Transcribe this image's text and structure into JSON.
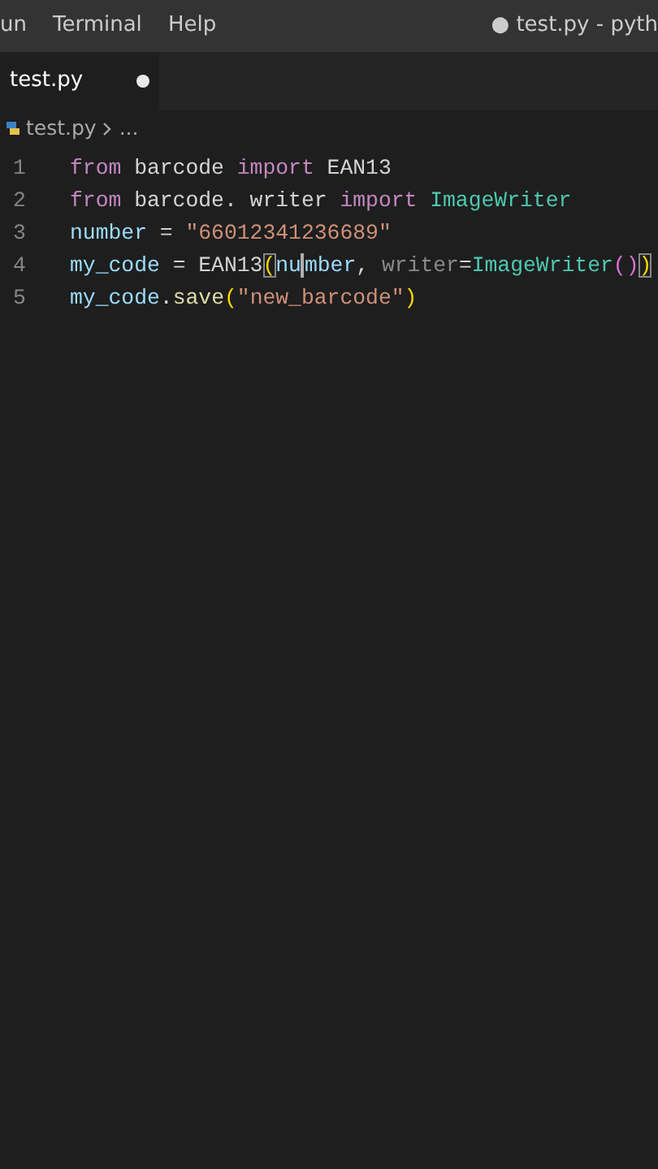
{
  "menu_bar": {
    "items": [
      "un",
      "Terminal",
      "Help"
    ],
    "title": "● test.py - pyth"
  },
  "tabs": [
    {
      "label": "test.py",
      "selected": true,
      "modified": true
    }
  ],
  "breadcrumb": [
    "test.py",
    "..."
  ],
  "code_lines": [
    {
      "number": "1",
      "tokens": [
        {
          "kind": "keyword",
          "text": "from"
        },
        {
          "kind": "plain",
          "text": " barcode "
        },
        {
          "kind": "keyword",
          "text": "import"
        },
        {
          "kind": "plain",
          "text": " EAN13"
        }
      ]
    },
    {
      "number": "2",
      "tokens": [
        {
          "kind": "keyword",
          "text": "from"
        },
        {
          "kind": "plain",
          "text": " barcode. writer "
        },
        {
          "kind": "keyword",
          "text": "import"
        },
        {
          "kind": "class",
          "text": " ImageWriter"
        }
      ]
    },
    {
      "number": "3",
      "tokens": [
        {
          "kind": "variable",
          "text": "number"
        },
        {
          "kind": "plain",
          "text": " = "
        },
        {
          "kind": "string",
          "text": "\"66012341236689\""
        }
      ]
    },
    {
      "number": "4",
      "tokens": [
        {
          "kind": "variable",
          "text": "my_code"
        },
        {
          "kind": "plain",
          "text": " = EAN13"
        },
        {
          "kind": "paren",
          "text": "(",
          "matched": true
        },
        {
          "kind": "variable",
          "text": "nu",
          "cursor_after": true
        },
        {
          "kind": "variable",
          "text": "mber"
        },
        {
          "kind": "plain",
          "text": ", "
        },
        {
          "kind": "param",
          "text": "writer"
        },
        {
          "kind": "plain",
          "text": "="
        },
        {
          "kind": "class",
          "text": "ImageWriter"
        },
        {
          "kind": "paren2",
          "text": "()"
        },
        {
          "kind": "paren",
          "text": ")",
          "matched": true
        }
      ]
    },
    {
      "number": "5",
      "tokens": [
        {
          "kind": "variable",
          "text": "my_code"
        },
        {
          "kind": "plain",
          "text": "."
        },
        {
          "kind": "function",
          "text": "save"
        },
        {
          "kind": "paren",
          "text": "("
        },
        {
          "kind": "string",
          "text": "\"new_barcode\""
        },
        {
          "kind": "paren",
          "text": ")"
        }
      ]
    }
  ]
}
